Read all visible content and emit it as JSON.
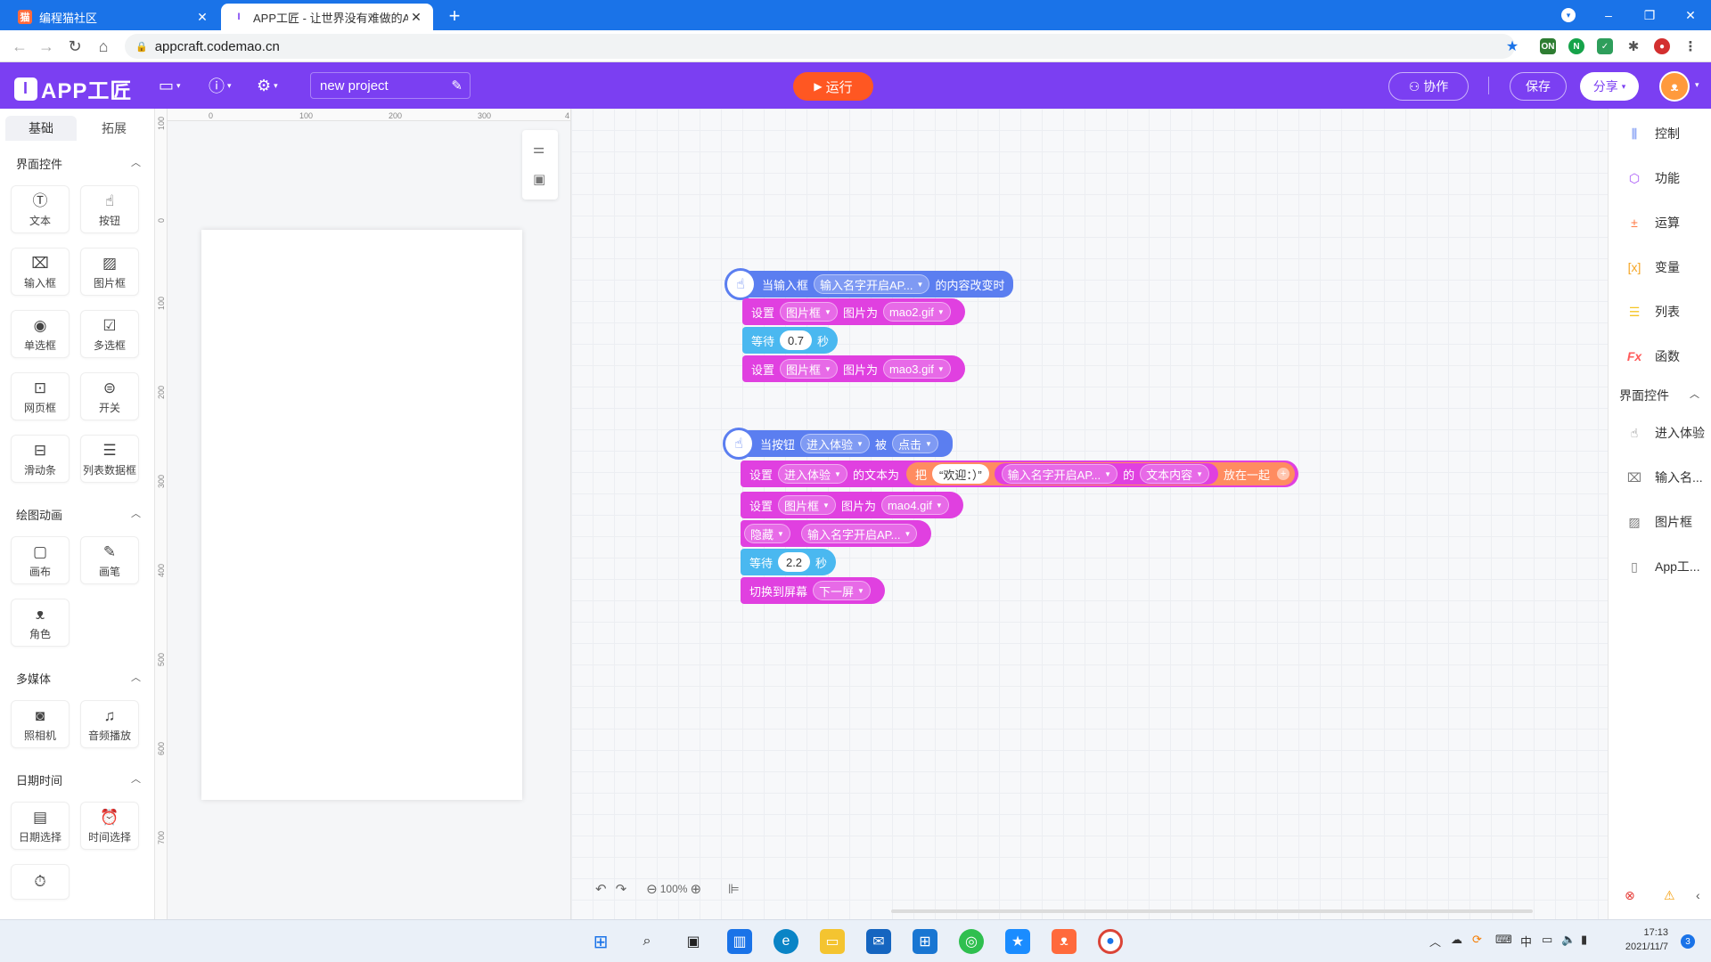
{
  "browser": {
    "tabs": [
      {
        "title": "编程猫社区",
        "active": false
      },
      {
        "title": "APP工匠 - 让世界没有难做的AP",
        "active": true
      }
    ],
    "new_tab": "+",
    "url": "appcraft.codemao.cn",
    "window_controls": {
      "minimize": "–",
      "restore": "❐",
      "close": "✕"
    }
  },
  "app": {
    "logo_text": "APP工匠",
    "project_name": "new project",
    "run_label": "运行",
    "collab_label": "协作",
    "save_label": "保存",
    "share_label": "分享",
    "accent_color": "#7b3ff2",
    "run_color": "#ff5722"
  },
  "left_panel": {
    "tabs": [
      "基础",
      "拓展"
    ],
    "sections": {
      "ui_controls": "界面控件",
      "drawing": "绘图动画",
      "media": "多媒体",
      "datetime": "日期时间"
    },
    "components": {
      "text": "文本",
      "button": "按钮",
      "input": "输入框",
      "image": "图片框",
      "radio": "单选框",
      "checkbox": "多选框",
      "webview": "网页框",
      "switch": "开关",
      "slider": "滑动条",
      "listview": "列表数据框",
      "canvas": "画布",
      "brush": "画笔",
      "sprite": "角色",
      "camera": "照相机",
      "audio": "音频播放",
      "date_picker": "日期选择",
      "time_picker": "时间选择"
    }
  },
  "ruler": {
    "h": [
      "0",
      "100",
      "200",
      "300",
      "4"
    ],
    "v": [
      "100",
      "0",
      "100",
      "200",
      "300",
      "400",
      "500",
      "600",
      "700"
    ]
  },
  "blocks": {
    "event1": {
      "prefix": "当输入框",
      "target": "输入名字开启AP...",
      "suffix": "的内容改变时"
    },
    "set1": {
      "label": "设置",
      "target": "图片框",
      "prop": "图片为",
      "value": "mao2.gif"
    },
    "wait1": {
      "label": "等待",
      "value": "0.7",
      "unit": "秒"
    },
    "set2": {
      "label": "设置",
      "target": "图片框",
      "prop": "图片为",
      "value": "mao3.gif"
    },
    "event2": {
      "prefix": "当按钮",
      "target": "进入体验",
      "mid": "被",
      "action": "点击"
    },
    "settext": {
      "label": "设置",
      "target": "进入体验",
      "prop": "的文本为",
      "join_prefix": "把",
      "str": "“欢迎：）”",
      "src": "输入名字开启AP...",
      "of": "的",
      "field": "文本内容",
      "join_suffix": "放在一起"
    },
    "set3": {
      "label": "设置",
      "target": "图片框",
      "prop": "图片为",
      "value": "mao4.gif"
    },
    "hide": {
      "action": "隐藏",
      "target": "输入名字开启AP..."
    },
    "wait2": {
      "label": "等待",
      "value": "2.2",
      "unit": "秒"
    },
    "switch": {
      "label": "切换到屏幕",
      "target": "下一屏"
    }
  },
  "workspace_toolbar": {
    "zoom": "100%"
  },
  "right_panel": {
    "categories": [
      "控制",
      "功能",
      "运算",
      "变量",
      "列表",
      "函数"
    ],
    "section": "界面控件",
    "controls": [
      "进入体验",
      "输入名...",
      "图片框",
      "App工..."
    ]
  },
  "taskbar": {
    "ime": "中",
    "time": "17:13",
    "date": "2021/11/7",
    "notifications": "3"
  }
}
